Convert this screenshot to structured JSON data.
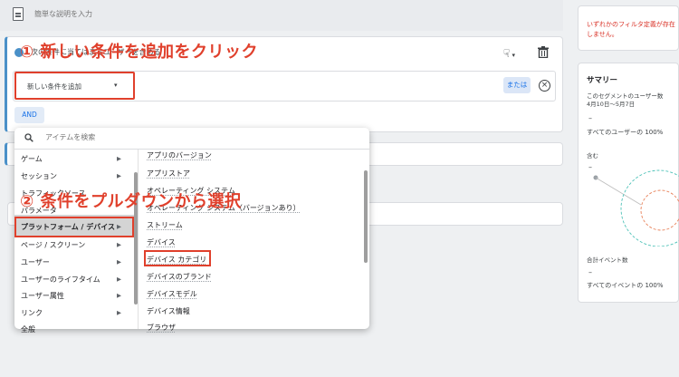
{
  "description": {
    "placeholder": "簡単な説明を入力"
  },
  "condition": {
    "title": "次の条件に当てはまるユーザーを含める",
    "add_condition_label": "新しい条件を追加",
    "or_label": "または",
    "and_label": "AND"
  },
  "annotations": {
    "step1": "① 新しい条件を追加をクリック",
    "step2": "② 条件をプルダウンから選択"
  },
  "filter_message": "いずれかのフィルタ定義が存在しません。",
  "summary": {
    "title": "サマリー",
    "seg_users_label": "このセグメントのユーザー数",
    "date_range": "4月10日～5月7日",
    "dash1": "–",
    "all_users_label": "すべてのユーザーの 100%",
    "include_label": "含む",
    "dash2": "–",
    "total_events_label": "合計イベント数",
    "dash3": "–",
    "all_events_label": "すべてのイベントの 100%"
  },
  "dropdown": {
    "search_placeholder": "アイテムを検索",
    "categories": [
      "ゲーム",
      "セッション",
      "トラフィックソース",
      "パラメータ",
      "プラットフォーム / デバイス",
      "ページ / スクリーン",
      "ユーザー",
      "ユーザーのライフタイム",
      "ユーザー属性",
      "リンク",
      "全般"
    ],
    "items": [
      "アプリのバージョン",
      "アプリストア",
      "オペレーティング システム",
      "オペレーティング システム（バージョンあり）",
      "ストリーム",
      "デバイス",
      "デバイス カテゴリ",
      "デバイスのブランド",
      "デバイスモデル",
      "デバイス情報",
      "ブラウザ"
    ]
  },
  "colors": {
    "accent": "#1a73e8",
    "annotation": "#e0402c",
    "segment_bar": "#4a90c8"
  }
}
